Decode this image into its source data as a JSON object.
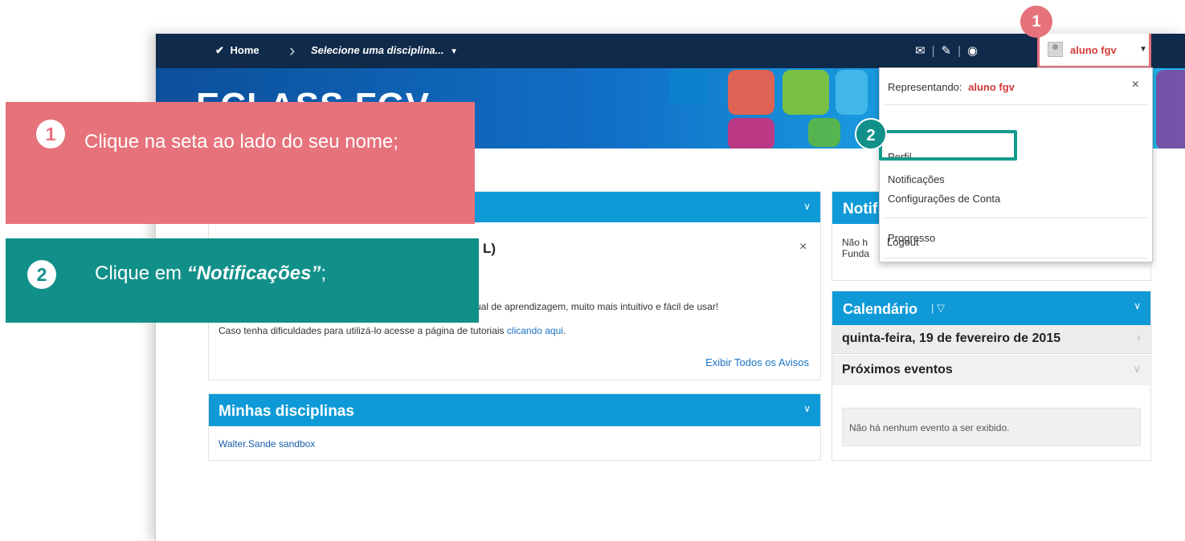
{
  "header": {
    "home": "Home",
    "course_select": "Selecione uma disciplina...",
    "user_name": "aluno fgv"
  },
  "banner": {
    "brand": "ECLASS FGV"
  },
  "dropdown": {
    "representing_label": "Representando:",
    "representing_user": "aluno fgv",
    "close": "×",
    "items": [
      "Perfil",
      "Notificações",
      "Configurações de Conta",
      "Progresso",
      "Logout"
    ]
  },
  "announcement": {
    "title_fragment": "L)",
    "close": "×",
    "line1_fragment": "ual de aprendizagem, muito mais intuitivo e fácil de usar!",
    "line2": "Caso tenha dificuldades para utilizá-lo acesse a página de tutoriais",
    "line2_link": "clicando aqui",
    "line2_end": ".",
    "view_all": "Exibir Todos os Avisos"
  },
  "my_courses": {
    "title": "Minhas disciplinas",
    "items": [
      "Walter.Sande sandbox"
    ]
  },
  "notifications_panel": {
    "title_fragment": "Notif",
    "text_line1": "Não h",
    "text_line2": "Funda"
  },
  "calendar": {
    "title": "Calendário",
    "date": "quinta-feira, 19 de fevereiro de 2015",
    "upcoming_title": "Próximos eventos",
    "empty_message": "Não há nenhum evento a ser exibido."
  },
  "callouts": {
    "step1_number": "1",
    "step1_text": "Clique na seta ao lado do seu nome;",
    "step2_number": "2",
    "step2_text_prefix": "Clique em ",
    "step2_text_emph": "“Notificações”",
    "step2_text_suffix": ";",
    "marker1": "1",
    "marker2": "2"
  },
  "colors": {
    "step1": "#e6727b",
    "step2": "#119089",
    "nav": "#0f2a4a",
    "panel_header": "#0f9ad7"
  }
}
